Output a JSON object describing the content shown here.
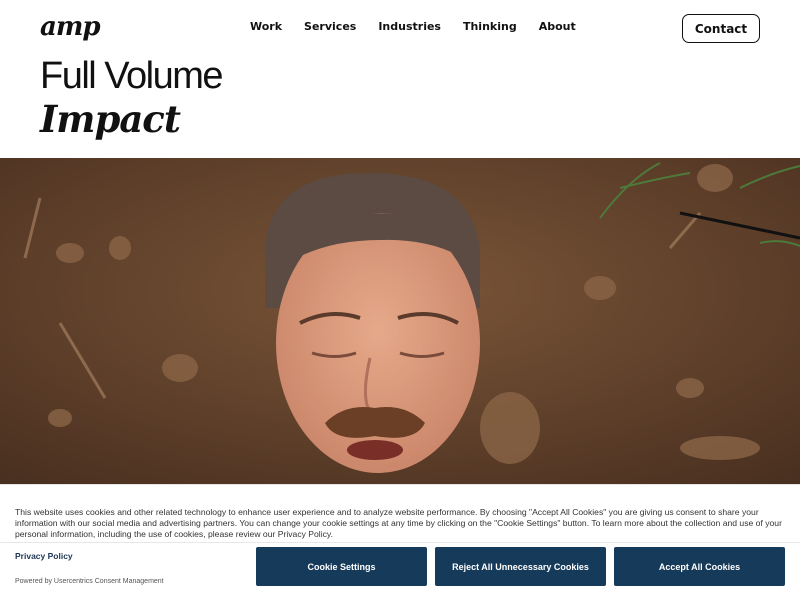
{
  "header": {
    "logo": "amp",
    "nav": [
      "Work",
      "Services",
      "Industries",
      "Thinking",
      "About"
    ],
    "contact_label": "Contact"
  },
  "hero": {
    "line1": "Full Volume",
    "line2": "Impact"
  },
  "cookie_banner": {
    "text": "This website uses cookies and other related technology to enhance user experience and to analyze website performance.  By choosing \"Accept All Cookies\" you are giving us consent to share your information with our social media and advertising partners. You can change your cookie settings at any time by clicking on the \"Cookie Settings\" button. To learn more about the collection and use of your personal information, including the use of cookies, please review our Privacy Policy.",
    "privacy_link": "Privacy Policy",
    "powered_by": "Powered by Usercentrics Consent Management",
    "settings_label": "Cookie Settings",
    "reject_label": "Reject All Unnecessary Cookies",
    "accept_label": "Accept All Cookies"
  },
  "colors": {
    "button_bg": "#163a5a",
    "soil": "#6a4a33"
  }
}
